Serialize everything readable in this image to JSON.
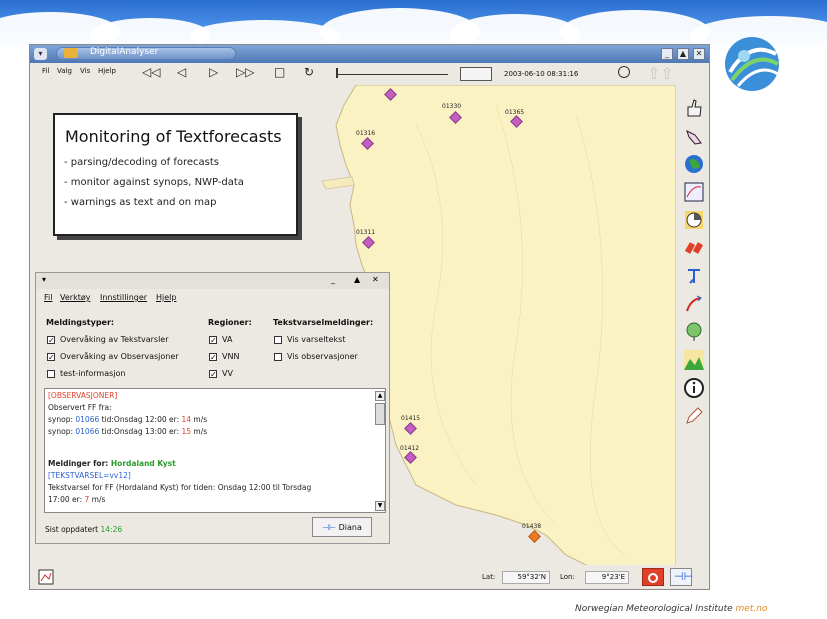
{
  "window": {
    "title": "DigitalAnalyser"
  },
  "menu": [
    "Fil",
    "Valg",
    "Vis",
    "Hjelp"
  ],
  "toolbar": {
    "first_icon": "fast-back-icon",
    "prev_icon": "step-back-icon",
    "play_icon": "play-icon",
    "next_icon": "fast-forward-icon",
    "stop_icon": "stop-icon",
    "refresh_icon": "refresh-icon",
    "datetime": "2003-06-10 08:31:16"
  },
  "slide": {
    "title": "Monitoring of Textforecasts",
    "bullets": [
      "- parsing/decoding of forecasts",
      "- monitor against synops, NWP-data",
      "- warnings as text and on map"
    ]
  },
  "stations": [
    {
      "id": "01330"
    },
    {
      "id": "01365"
    },
    {
      "id": "01316"
    },
    {
      "id": "01311"
    },
    {
      "id": "01415"
    },
    {
      "id": "01412"
    },
    {
      "id": "01438"
    }
  ],
  "subwindow": {
    "menu": [
      "Fil",
      "Verktøy",
      "Innstillinger",
      "Hjelp"
    ],
    "groups": {
      "meldingstyper": {
        "title": "Meldingstyper:",
        "items": [
          {
            "label": "Overvåking av Tekstvarsler",
            "checked": true
          },
          {
            "label": "Overvåking av Observasjoner",
            "checked": true
          },
          {
            "label": "test-informasjon",
            "checked": false
          }
        ]
      },
      "regioner": {
        "title": "Regioner:",
        "items": [
          {
            "label": "VA",
            "checked": true
          },
          {
            "label": "VNN",
            "checked": true
          },
          {
            "label": "VV",
            "checked": true
          }
        ]
      },
      "tekstvarsel": {
        "title": "Tekstvarselmeldinger:",
        "items": [
          {
            "label": "Vis varseltekst",
            "checked": false
          },
          {
            "label": "Vis observasjoner",
            "checked": false
          }
        ]
      }
    },
    "messages": {
      "obs_tag": "[OBSERVASJONER]",
      "observed": "Observert FF fra:",
      "line1_prefix": "synop:",
      "line1_station": "01066",
      "line1_mid": "tid:Onsdag 12:00 er:",
      "line1_value": "14",
      "line1_unit": "m/s",
      "line2_prefix": "synop:",
      "line2_station": "01066",
      "line2_mid": "tid:Onsdag 13:00 er:",
      "line2_value": "15",
      "line2_unit": "m/s",
      "meldinger_prefix": "Meldinger for:",
      "meldinger_region": "Hordaland Kyst",
      "varsel_tag": "[TEKSTVARSEL=vv12]",
      "varsel_text": "Tekstvarsel for FF (Hordaland Kyst) for tiden: Onsdag 12:00 til Torsdag",
      "varsel_text2_prefix": "17:00 er:",
      "varsel_value": "7",
      "varsel_unit": "m/s"
    },
    "last_updated_label": "Sist oppdatert",
    "last_updated_value": "14:26",
    "diana_button": "Diana"
  },
  "status": {
    "lat_label": "Lat:",
    "lat_value": "59°32'N",
    "lon_label": "Lon:",
    "lon_value": "9°23'E"
  },
  "footer": {
    "institute": "Norwegian Meteorological Institute",
    "brand": "met.no"
  },
  "colors": {
    "station": "#c25fc0",
    "warning_station": "#ef7a22",
    "titlebar": "#4f79b6",
    "highlight_red": "#e0402a",
    "highlight_blue": "#2a5fd0",
    "highlight_green": "#2a9a2a"
  }
}
